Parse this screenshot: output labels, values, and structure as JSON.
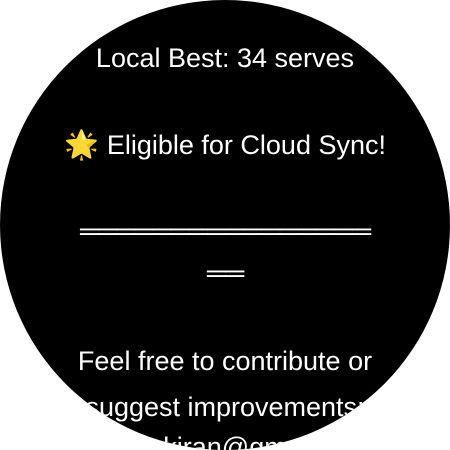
{
  "screen": {
    "local_best": "Local Best: 34 serves",
    "eligible_icon": "glowing-star-icon",
    "eligible_glyph": "🌟",
    "eligible_text": "Eligible for Cloud Sync!",
    "separator_line_1": "════════════════",
    "separator_line_2": "══",
    "contribute_text": "Feel free to contribute or",
    "suggest_text": "suggest improvements:",
    "email_partial": "kiran@gm"
  },
  "colors": {
    "background": "#000000",
    "text": "#ffffff"
  }
}
